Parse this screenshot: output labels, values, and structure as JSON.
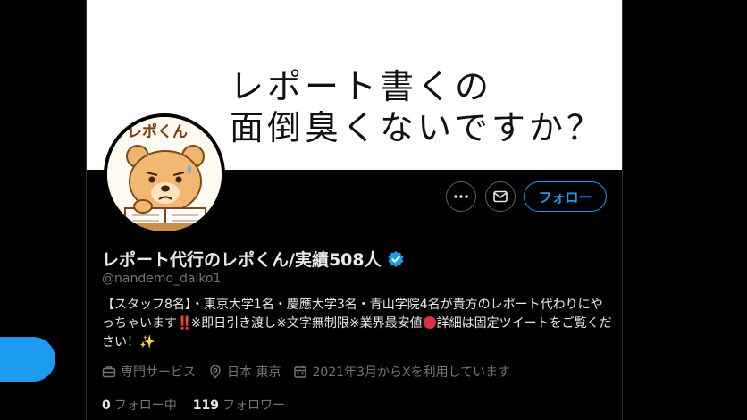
{
  "banner": {
    "line1": "レポート書くの",
    "line2": "面倒臭くないですか？"
  },
  "avatar": {
    "label": "レポくん"
  },
  "actions": {
    "more_icon": "more-horizontal-icon",
    "message_icon": "envelope-icon",
    "follow_label": "フォロー"
  },
  "profile": {
    "name": "レポート代行のレポくん/実績508人",
    "handle": "@nandemo_daiko1",
    "bio_part1": "【スタッフ8名】・東京大学1名・慶應大学3名・青山学院4名が貴方のレポート代わりにやっちゃいます",
    "bio_part2": "※即日引き渡し※文字無制限※業界最安値",
    "bio_part3": "詳細は固定ツイートをご覧ください！",
    "bang_glyph": "‼️",
    "sparkle_glyph": "✨"
  },
  "meta": {
    "category": "専門サービス",
    "location": "日本 東京",
    "joined": "2021年3月からXを利用しています"
  },
  "counts": {
    "following_num": "0",
    "following_label": "フォロー中",
    "followers_num": "119",
    "followers_label": "フォロワー"
  },
  "colors": {
    "accent": "#1d9bf0",
    "background": "#000000",
    "text_primary": "#e7e9ea",
    "text_secondary": "#71767b",
    "alert_red": "#dd2e44"
  }
}
